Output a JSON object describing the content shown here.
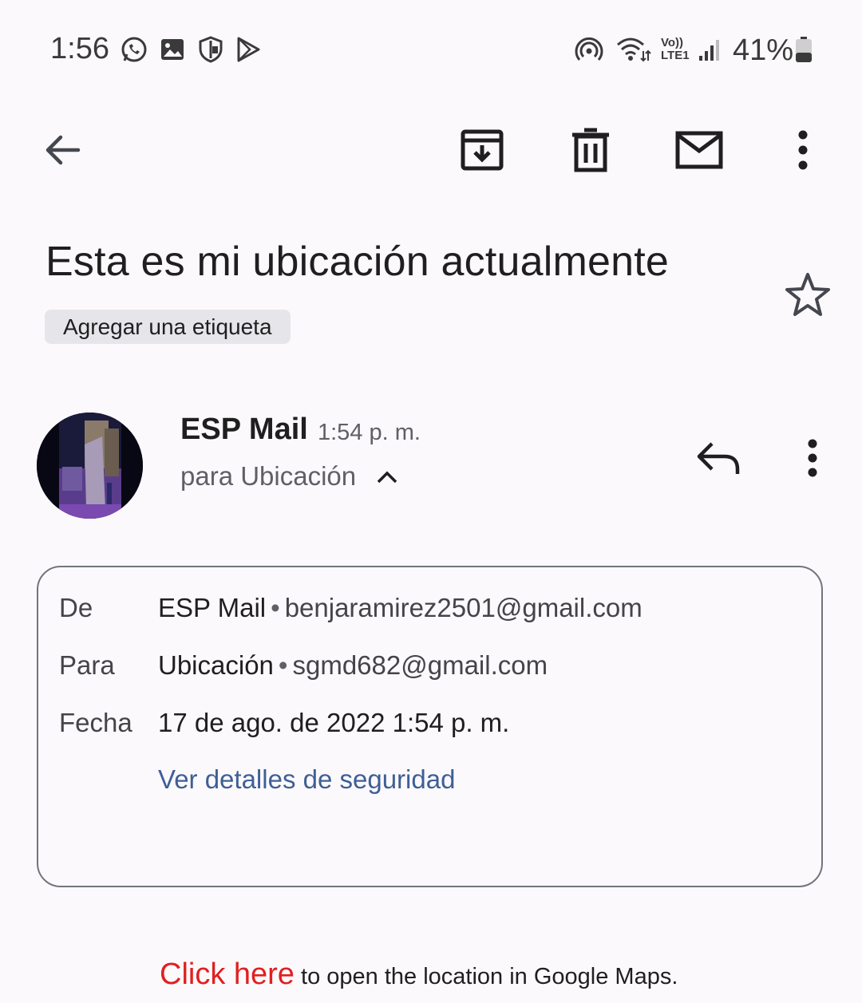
{
  "status_bar": {
    "time": "1:56",
    "left_icons": [
      "whatsapp-icon",
      "gallery-icon",
      "shield-icon",
      "play-store-icon"
    ],
    "right_icons": [
      "hotspot-icon",
      "wifi-icon",
      "volte-icon",
      "signal-icon",
      "battery-icon"
    ],
    "volte_top": "Vo))",
    "volte_bottom": "LTE1",
    "battery_percent": "41%",
    "battery_level": 0.41
  },
  "toolbar": {
    "icons": [
      "back-arrow-icon",
      "archive-icon",
      "delete-icon",
      "mark-unread-icon",
      "more-vert-icon"
    ]
  },
  "email": {
    "subject": "Esta es mi ubicación actualmente",
    "label_chip": "Agregar una etiqueta",
    "sender_name": "ESP Mail",
    "sent_time": "1:54 p. m.",
    "recipient_summary": "para Ubicación"
  },
  "details": {
    "from_label": "De",
    "from_name": "ESP Mail",
    "from_email": "benjaramirez2501@gmail.com",
    "to_label": "Para",
    "to_name": "Ubicación",
    "to_email": "sgmd682@gmail.com",
    "date_label": "Fecha",
    "date_value": "17 de ago. de 2022 1:54 p. m.",
    "separator": "•",
    "security_link": "Ver detalles de seguridad"
  },
  "body": {
    "link_text": "Click here",
    "rest_text": " to open the location in Google Maps."
  },
  "colors": {
    "background": "#fcf9fc",
    "link_red": "#e02020",
    "security_link": "#3e5f96",
    "chip_bg": "#e6e6ea"
  }
}
